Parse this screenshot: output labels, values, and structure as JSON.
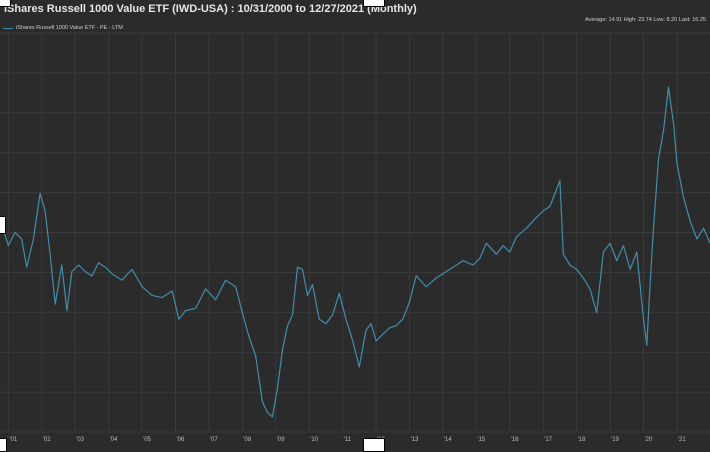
{
  "chart_data": {
    "type": "line",
    "title": "iShares Russell 1000 Value ETF (IWD-USA)   :   10/31/2000 to 12/27/2021 (Monthly)",
    "stats": "Average: 14.91 High: 23.74 Low: 8.20 Last: 16.25",
    "legend": "iShares Russell 1000 Value ETF - PE - LTM",
    "x_tick_labels": [
      "'01",
      "'02",
      "'03",
      "'04",
      "'05",
      "'06",
      "'07",
      "'08",
      "'09",
      "'10",
      "'11",
      "'12",
      "'13",
      "'14",
      "'15",
      "'16",
      "'17",
      "'18",
      "'19",
      "'20",
      "'21"
    ],
    "x_range": [
      2000.75,
      2021.99
    ],
    "ylim": [
      7.6,
      26.0
    ],
    "grid": true,
    "series_color": "#3e8fae",
    "series": [
      {
        "name": "iShares Russell 1000 Value ETF - PE - LTM",
        "x": [
          2000.83,
          2001.0,
          2001.2,
          2001.4,
          2001.55,
          2001.75,
          2001.95,
          2002.1,
          2002.25,
          2002.4,
          2002.6,
          2002.75,
          2002.9,
          2003.1,
          2003.3,
          2003.5,
          2003.7,
          2003.9,
          2004.1,
          2004.4,
          2004.7,
          2005.0,
          2005.3,
          2005.6,
          2005.9,
          2006.1,
          2006.3,
          2006.6,
          2006.9,
          2007.2,
          2007.5,
          2007.8,
          2008.0,
          2008.2,
          2008.4,
          2008.6,
          2008.75,
          2008.9,
          2009.05,
          2009.2,
          2009.35,
          2009.5,
          2009.65,
          2009.8,
          2009.95,
          2010.1,
          2010.3,
          2010.5,
          2010.7,
          2010.9,
          2011.1,
          2011.3,
          2011.5,
          2011.7,
          2011.85,
          2012.0,
          2012.2,
          2012.4,
          2012.6,
          2012.8,
          2013.0,
          2013.2,
          2013.5,
          2013.8,
          2014.0,
          2014.3,
          2014.6,
          2014.9,
          2015.1,
          2015.3,
          2015.6,
          2015.8,
          2016.0,
          2016.2,
          2016.5,
          2016.8,
          2017.0,
          2017.2,
          2017.4,
          2017.5,
          2017.6,
          2017.8,
          2018.0,
          2018.2,
          2018.4,
          2018.6,
          2018.8,
          2019.0,
          2019.2,
          2019.4,
          2019.6,
          2019.8,
          2020.0,
          2020.1,
          2020.2,
          2020.3,
          2020.45,
          2020.6,
          2020.75,
          2020.9,
          2021.0,
          2021.2,
          2021.4,
          2021.6,
          2021.8,
          2021.99
        ],
        "values": [
          17.0,
          16.2,
          16.8,
          16.5,
          15.2,
          16.5,
          18.6,
          17.8,
          15.8,
          13.5,
          15.3,
          13.2,
          15.0,
          15.3,
          15.0,
          14.8,
          15.4,
          15.2,
          14.9,
          14.6,
          15.1,
          14.3,
          13.9,
          13.8,
          14.1,
          12.8,
          13.2,
          13.3,
          14.2,
          13.7,
          14.6,
          14.3,
          13.1,
          12.0,
          11.1,
          9.0,
          8.5,
          8.3,
          9.6,
          11.4,
          12.5,
          13.0,
          15.2,
          15.1,
          13.9,
          14.4,
          12.8,
          12.6,
          13.0,
          14.0,
          12.8,
          11.8,
          10.6,
          12.3,
          12.6,
          11.8,
          12.1,
          12.4,
          12.5,
          12.8,
          13.6,
          14.8,
          14.3,
          14.7,
          14.9,
          15.2,
          15.5,
          15.3,
          15.6,
          16.3,
          15.8,
          16.2,
          15.9,
          16.6,
          17.0,
          17.5,
          17.8,
          18.0,
          18.8,
          19.2,
          15.8,
          15.3,
          15.1,
          14.7,
          14.2,
          13.1,
          15.9,
          16.3,
          15.5,
          16.2,
          15.1,
          15.9,
          12.8,
          11.6,
          14.5,
          17.0,
          20.2,
          21.5,
          23.5,
          21.8,
          20.0,
          18.4,
          17.3,
          16.5,
          17.0,
          16.3
        ]
      }
    ]
  }
}
